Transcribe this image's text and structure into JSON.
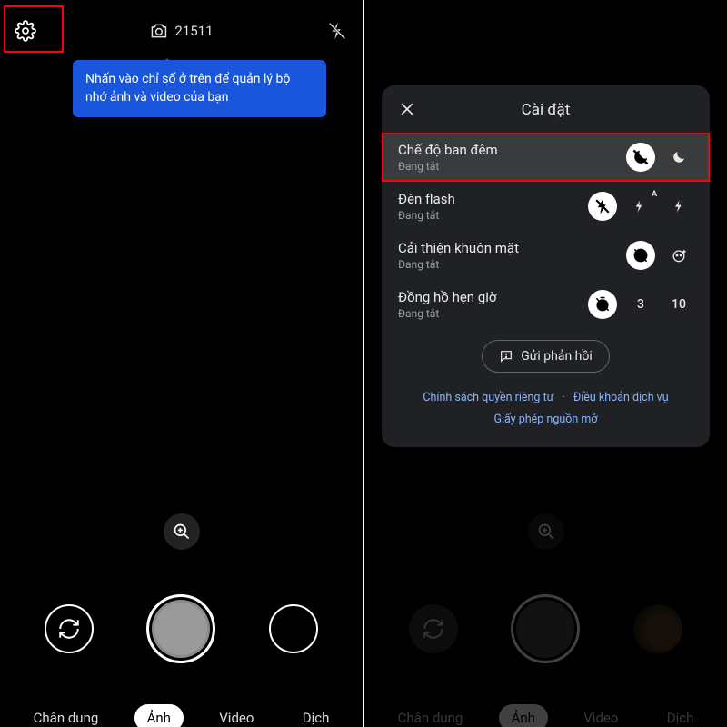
{
  "colors": {
    "accent": "#1a56db",
    "link": "#8ab4f8",
    "highlight": "#ff0010"
  },
  "left_screen": {
    "photo_count": "21511",
    "tooltip_text": "Nhấn vào chỉ số ở trên để quản lý bộ nhớ ảnh và video của bạn",
    "modes": [
      "Chân dung",
      "Ảnh",
      "Video",
      "Dịch"
    ],
    "active_mode_index": 1
  },
  "right_screen": {
    "modes": [
      "Chân dung",
      "Ảnh",
      "Video",
      "Dịch"
    ],
    "active_mode_index": 1
  },
  "settings_panel": {
    "title": "Cài đặt",
    "rows": [
      {
        "label": "Chế độ ban đêm",
        "sub": "Đang tắt",
        "selected": true,
        "options": [
          "night-off-icon",
          "moon-icon"
        ],
        "active_option": 0
      },
      {
        "label": "Đèn flash",
        "sub": "Đang tắt",
        "selected": false,
        "options": [
          "flash-off-icon",
          "flash-auto-icon",
          "flash-on-icon"
        ],
        "active_option": 0
      },
      {
        "label": "Cải thiện khuôn mặt",
        "sub": "Đang tắt",
        "selected": false,
        "options": [
          "face-off-icon",
          "face-sparkle-icon"
        ],
        "active_option": 0
      },
      {
        "label": "Đồng hồ hẹn giờ",
        "sub": "Đang tắt",
        "selected": false,
        "options": [
          "timer-off-icon",
          "3",
          "10"
        ],
        "active_option": 0
      }
    ],
    "feedback_label": "Gửi phản hồi",
    "links": {
      "privacy": "Chính sách quyền riêng tư",
      "terms": "Điều khoản dịch vụ",
      "license": "Giấy phép nguồn mở"
    }
  }
}
